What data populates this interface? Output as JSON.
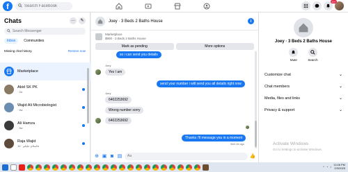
{
  "topbar": {
    "search_placeholder": "Search Facebook",
    "notification_count": "20+"
  },
  "sidebar": {
    "title": "Chats",
    "search_placeholder": "Search Messenger",
    "tabs": [
      "Inbox",
      "Communities"
    ],
    "missing_history": "Missing chat history.",
    "restore_link": "Restore now",
    "chats": [
      {
        "name": "Marketplace",
        "sub": "",
        "color": "#1877f2",
        "unread": false
      },
      {
        "name": "Abid SK PK",
        "sub": "· 2d",
        "color": "#8b7a63",
        "unread": true
      },
      {
        "name": "Wajid Ali Microbiologist",
        "sub": "· 5w",
        "color": "#6a8db0",
        "unread": true
      },
      {
        "name": "Ali Hamza",
        "sub": "· 5w",
        "color": "#3b3b3b",
        "unread": true
      },
      {
        "name": "Raja Wajid",
        "sub": "اسلام علیکم · 10w",
        "color": "#5e4a3a",
        "unread": true
      }
    ]
  },
  "conversation": {
    "title": "Joey · 3 Beds 2 Baths House",
    "marketplace_label": "Marketplace",
    "listing": "$900 - 3 Beds 2 Baths House",
    "mark_pending": "Mark as pending",
    "more_options": "More options",
    "messages": {
      "out_1": "so i can send you details",
      "sender_1": "Joey",
      "in_1": "Yes I am",
      "out_2": "send your number i will send you all details right now",
      "sender_2": "Joey",
      "in_2": "6402253692",
      "in_3": "Wrong number sorry",
      "in_4": "6402253692",
      "out_3": "Thanks i'll message you in a moment",
      "seen": "Sent 2m ago"
    },
    "composer_placeholder": "Aa"
  },
  "right_panel": {
    "name": "Joey · 3 Beds 2 Baths House",
    "mute": "Mute",
    "search": "Search",
    "menu": [
      "Customize chat",
      "Chat members",
      "Media, files and links",
      "Privacy & support"
    ]
  },
  "watermark": {
    "title": "Activate Windows",
    "sub": "Go to Settings to activate Windows."
  },
  "taskbar": {
    "time": "11:08 PM",
    "date": "2/3/2025"
  }
}
